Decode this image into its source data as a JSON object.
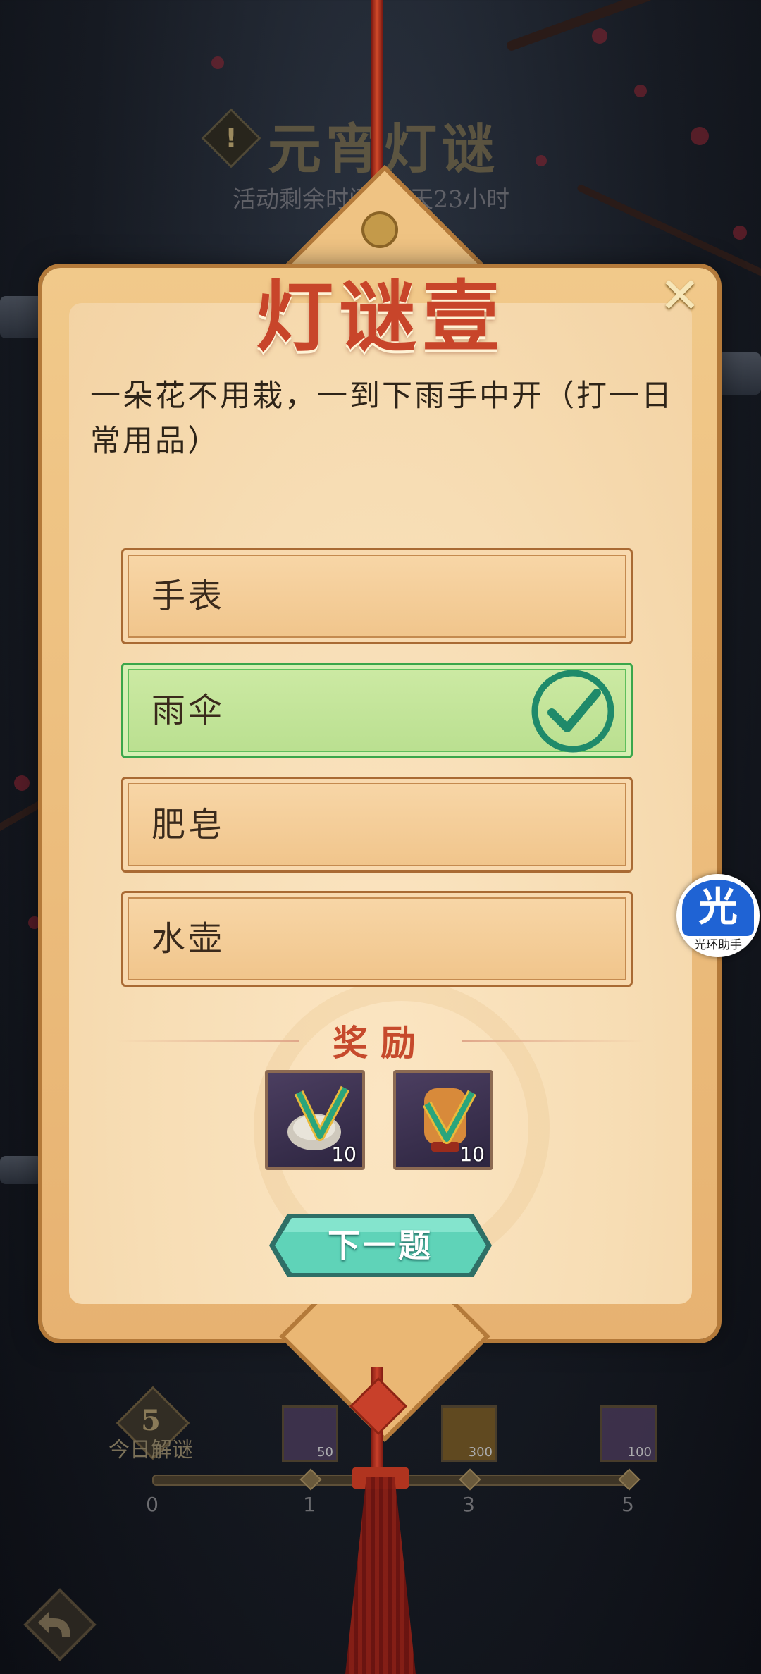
{
  "header": {
    "title": "元宵灯谜",
    "time_remaining": "活动剩余时间：2天23小时"
  },
  "puzzle": {
    "title": "灯谜壹",
    "question": "一朵花不用栽，一到下雨手中开（打一日常用品）",
    "options": [
      {
        "label": "手表",
        "state": "normal"
      },
      {
        "label": "雨伞",
        "state": "correct"
      },
      {
        "label": "肥皂",
        "state": "normal"
      },
      {
        "label": "水壶",
        "state": "normal"
      }
    ],
    "reward_title": "奖励",
    "rewards": [
      {
        "icon": "jade-scroll-bowl-icon",
        "qty": "10"
      },
      {
        "icon": "jade-scroll-lantern-icon",
        "qty": "10"
      }
    ],
    "next_label": "下一题"
  },
  "helper": {
    "glyph": "光",
    "label": "光环助手"
  },
  "progress": {
    "daily_count": "5",
    "daily_label": "今日解谜",
    "nodes": [
      "0",
      "1",
      "3",
      "5"
    ],
    "milestones": [
      {
        "icon": "bowl-icon",
        "qty": "50"
      },
      {
        "icon": "ingot-icon",
        "qty": "300"
      },
      {
        "icon": "bowl-icon",
        "qty": "100"
      }
    ]
  },
  "colors": {
    "accent_red": "#c8452a",
    "correct_green": "#3aa64a",
    "panel": "#f1c98a"
  }
}
